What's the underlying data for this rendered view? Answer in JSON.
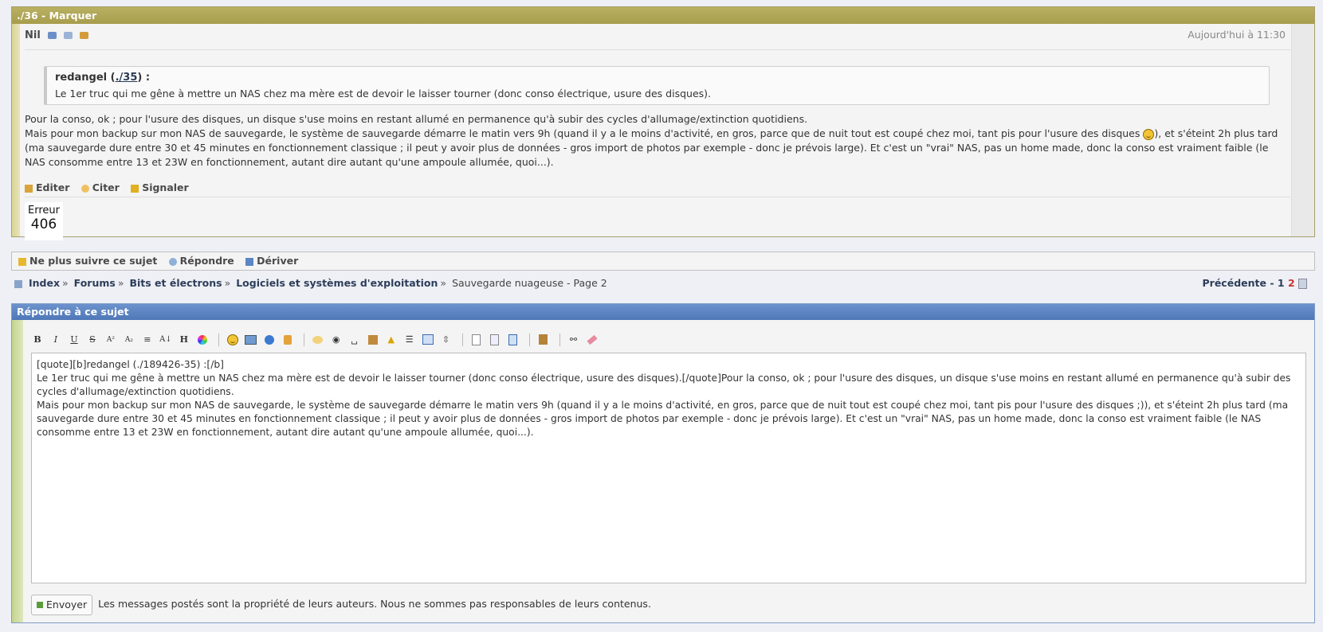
{
  "post": {
    "title": "./36 - Marquer",
    "author": "Nil",
    "date": "Aujourd'hui à 11:30",
    "quote": {
      "author": "redangel",
      "link": "./35",
      "suffix": ") :",
      "prefix": " (",
      "text": "Le 1er truc qui me gêne à mettre un NAS chez ma mère est de devoir le laisser tourner (donc conso électrique, usure des disques)."
    },
    "body_line1": "Pour la conso, ok ; pour l'usure des disques, un disque s'use moins en restant allumé en permanence qu'à subir des cycles d'allumage/extinction quotidiens.",
    "body_line2a": "Mais pour mon backup sur mon NAS de sauvegarde, le système de sauvegarde démarre le matin vers 9h (quand il y a le moins d'activité, en gros, parce que de nuit tout est coupé chez moi, tant pis pour l'usure des disques ",
    "body_line2b": "), et s'éteint 2h plus tard (ma sauvegarde dure entre 30 et 45 minutes en fonctionnement classique ; il peut y avoir plus de données - gros import de photos par exemple - donc je prévois large). Et c'est un \"vrai\" NAS, pas un home made, donc la conso est vraiment faible (le NAS consomme entre 13 et 23W en fonctionnement, autant dire autant qu'une ampoule allumée, quoi...).",
    "actions": {
      "edit": "Editer",
      "quote": "Citer",
      "report": "Signaler"
    },
    "error": {
      "label": "Erreur",
      "code": "406"
    }
  },
  "follow": {
    "unfollow": "Ne plus suivre ce sujet",
    "reply": "Répondre",
    "derive": "Dériver"
  },
  "breadcrumb": {
    "items": [
      "Index",
      "Forums",
      "Bits et électrons",
      "Logiciels et systèmes d'exploitation"
    ],
    "current": "Sauvegarde nuageuse - Page 2",
    "sep": "»"
  },
  "pager": {
    "prev": "Précédente",
    "dash": " - ",
    "page1": "1",
    "page2": "2"
  },
  "reply": {
    "title": "Répondre à ce sujet",
    "message": "[quote][b]redangel (./189426-35) :[/b]\nLe 1er truc qui me gêne à mettre un NAS chez ma mère est de devoir le laisser tourner (donc conso électrique, usure des disques).[/quote]Pour la conso, ok ; pour l'usure des disques, un disque s'use moins en restant allumé en permanence qu'à subir des cycles d'allumage/extinction quotidiens.\nMais pour mon backup sur mon NAS de sauvegarde, le système de sauvegarde démarre le matin vers 9h (quand il y a le moins d'activité, en gros, parce que de nuit tout est coupé chez moi, tant pis pour l'usure des disques ;)), et s'éteint 2h plus tard (ma sauvegarde dure entre 30 et 45 minutes en fonctionnement classique ; il peut y avoir plus de données - gros import de photos par exemple - donc je prévois large). Et c'est un \"vrai\" NAS, pas un home made, donc la conso est vraiment faible (le NAS consomme entre 13 et 23W en fonctionnement, autant dire autant qu'une ampoule allumée, quoi...).",
    "send": "Envoyer",
    "disclaimer": "Les messages postés sont la propriété de leurs auteurs. Nous ne sommes pas responsables de leurs contenus."
  },
  "toolbar": {
    "bold": "B",
    "italic": "I",
    "underline": "U",
    "strike": "S",
    "sup": "A²",
    "sub": "A₂",
    "heading": "H"
  },
  "colors": {
    "post_title_bar": "#b0a757",
    "reply_title_bar": "#5b82c0",
    "link": "#2e3e5a",
    "current_page": "#cc3333"
  }
}
